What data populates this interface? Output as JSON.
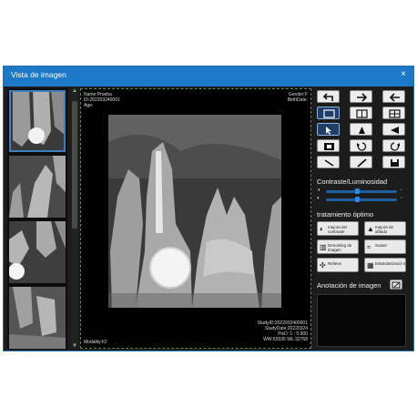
{
  "window": {
    "title": "Vista de imagen",
    "close_glyph": "×"
  },
  "overlay": {
    "top_left": [
      "Name:Prueba",
      "ID:202203240001",
      "Age:"
    ],
    "top_right": [
      "Gender:F",
      "BirthDate:"
    ],
    "bottom_right": [
      "StudyID:2022032400001",
      "StudyDate:20220324",
      "PixD: 1 : 0.900",
      "WW:65535   WL:32768"
    ],
    "bottom_left": "Modality:IO"
  },
  "panel": {
    "contrast_title": "Contraste/Luminosidad",
    "treatment_title": "tratamiento óptimo",
    "annotation_title": "Anotación de imagen",
    "brightness": 0.32,
    "contrast": 0.32,
    "optimize_buttons": [
      {
        "label": "mejora del contraste",
        "icon": "contrast-icon"
      },
      {
        "label": "mejora de afilado",
        "icon": "sharpen-icon"
      },
      {
        "label": "Denoising de imagen",
        "icon": "denoise-icon"
      },
      {
        "label": "Suave",
        "icon": "smooth-icon"
      },
      {
        "label": "Relieve",
        "icon": "relief-icon"
      },
      {
        "label": "Estandarizació n",
        "icon": "standardize-icon"
      }
    ]
  },
  "toolbar": [
    "undo-icon",
    "redo-arrow-icon",
    "back-arrow-icon",
    "single-view-icon",
    "dual-view-icon",
    "quad-view-icon",
    "select-pointer-icon",
    "sharpen-tool-icon",
    "angle-tool-icon",
    "invert-icon",
    "rotate-left-icon",
    "rotate-right-icon",
    "measure-line-icon",
    "pen-icon",
    "save-icon"
  ]
}
